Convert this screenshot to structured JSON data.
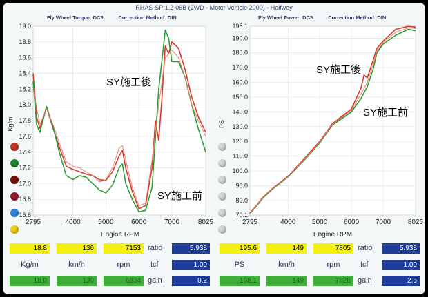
{
  "header": "RHAS-SP 1.2-06B  (2WD - Motor Vehicle 2000) - Halfway",
  "left_panel": {
    "title": "Fly Wheel Torque: DC5",
    "correction": "Correction Method: DIN",
    "readout": {
      "val1": "18.8",
      "val2": "136",
      "val3": "7153",
      "unit1": "Kg/m",
      "unit2": "km/h",
      "unit3": "rpm",
      "cmp1": "18.0",
      "cmp2": "130",
      "cmp3": "6834",
      "ratio_label": "ratio",
      "ratio": "5.938",
      "tcf_label": "tcf",
      "tcf": "1.00",
      "gain_label": "gain",
      "gain": "0.2"
    }
  },
  "right_panel": {
    "title": "Fly Wheel Power: DC5",
    "correction": "Correction Method: DIN",
    "readout": {
      "val1": "195.6",
      "val2": "149",
      "val3": "7805",
      "unit1": "PS",
      "unit2": "km/h",
      "unit3": "rpm",
      "cmp1": "198.1",
      "cmp2": "149",
      "cmp3": "7828",
      "ratio_label": "ratio",
      "ratio": "5.938",
      "tcf_label": "tcf",
      "tcf": "1.00",
      "gain_label": "gain",
      "gain": "2.6"
    }
  },
  "left_swatches": [
    "#c0392b",
    "#1e8c2e",
    "#7a1010",
    "#9b1c2c",
    "#2e86de",
    "#f1d21a"
  ],
  "right_swatches": [
    "#d6d6d6",
    "#d6d6d6",
    "#d6d6d6",
    "#d6d6d6",
    "#d6d6d6",
    "#d6d6d6"
  ],
  "chart_data": [
    {
      "type": "line",
      "title": "Fly Wheel Torque: DC5",
      "xlabel": "Engine RPM",
      "ylabel": "Kg/m",
      "xlim": [
        2795,
        8025
      ],
      "ylim": [
        16.6,
        19.0
      ],
      "x_ticks": [
        2795,
        4000,
        5000,
        6000,
        7000,
        8025
      ],
      "y_ticks": [
        16.6,
        16.8,
        17.0,
        17.2,
        17.4,
        17.6,
        17.8,
        18.0,
        18.2,
        18.4,
        18.6,
        18.8,
        19.0
      ],
      "annotations": [
        "SY施工後",
        "SY施工前"
      ],
      "series": [
        {
          "color": "#d63a2a",
          "x": [
            2795,
            2900,
            3000,
            3200,
            3400,
            3600,
            3800,
            4000,
            4200,
            4400,
            4600,
            4800,
            5000,
            5200,
            5400,
            5500,
            5600,
            5800,
            6000,
            6200,
            6400,
            6500,
            6600,
            6700,
            6800,
            6900,
            7000,
            7200,
            7400,
            7600,
            7800,
            8025
          ],
          "y": [
            18.4,
            17.85,
            17.7,
            17.97,
            17.7,
            17.45,
            17.22,
            17.18,
            17.15,
            17.12,
            17.1,
            17.05,
            17.04,
            17.15,
            17.35,
            17.42,
            17.2,
            16.9,
            16.68,
            16.72,
            17.2,
            17.8,
            17.55,
            18.1,
            18.75,
            18.65,
            18.8,
            18.72,
            18.45,
            18.1,
            17.85,
            17.65
          ]
        },
        {
          "color": "#2a9d35",
          "x": [
            2795,
            2900,
            3000,
            3200,
            3400,
            3600,
            3800,
            4000,
            4200,
            4400,
            4600,
            4800,
            5000,
            5200,
            5400,
            5500,
            5600,
            5800,
            6000,
            6200,
            6400,
            6600,
            6800,
            6900,
            7000,
            7200,
            7400,
            7600,
            7800,
            8025
          ],
          "y": [
            18.3,
            17.75,
            17.65,
            17.98,
            17.72,
            17.38,
            17.1,
            17.05,
            17.1,
            17.08,
            17.0,
            16.92,
            16.88,
            16.98,
            17.2,
            17.25,
            17.0,
            16.8,
            16.64,
            16.66,
            16.95,
            18.2,
            18.95,
            18.85,
            18.55,
            18.55,
            18.35,
            18.0,
            17.7,
            17.4
          ]
        },
        {
          "color": "#e57d72",
          "x": [
            2795,
            3000,
            3200,
            3400,
            3600,
            3800,
            4000,
            4200,
            4400,
            4600,
            4800,
            5000,
            5200,
            5400,
            5500,
            5600,
            5800,
            6000,
            6200,
            6400,
            6600,
            6800,
            7000,
            7200,
            7400,
            7600,
            7800,
            8025
          ],
          "y": [
            18.2,
            17.75,
            17.95,
            17.75,
            17.5,
            17.28,
            17.22,
            17.2,
            17.15,
            17.1,
            17.02,
            17.05,
            17.2,
            17.45,
            17.48,
            17.3,
            16.95,
            16.72,
            16.75,
            17.3,
            18.0,
            18.6,
            18.7,
            18.6,
            18.35,
            18.0,
            17.8,
            17.6
          ]
        }
      ]
    },
    {
      "type": "line",
      "title": "Fly Wheel Power: DC5",
      "xlabel": "Engine RPM",
      "ylabel": "PS",
      "xlim": [
        2795,
        8025
      ],
      "ylim": [
        70.1,
        198.1
      ],
      "x_ticks": [
        2795,
        4000,
        5000,
        6000,
        7000,
        8025
      ],
      "y_ticks": [
        70.1,
        80.0,
        90.0,
        100.0,
        110.0,
        120.0,
        130.0,
        140.0,
        150.0,
        160.0,
        170.0,
        180.0,
        190.0,
        198.1
      ],
      "annotations": [
        "SY施工後",
        "SY施工前"
      ],
      "series": [
        {
          "color": "#d63a2a",
          "x": [
            2795,
            3000,
            3200,
            3500,
            4000,
            4500,
            5000,
            5400,
            6000,
            6300,
            6400,
            6500,
            6700,
            6800,
            7000,
            7400,
            7800,
            8025
          ],
          "y": [
            71.5,
            76.5,
            82.0,
            88.0,
            96.5,
            108.0,
            120.0,
            132.0,
            142.0,
            156.0,
            165.0,
            163.0,
            176.0,
            183.0,
            188.0,
            196.0,
            198.0,
            197.5
          ]
        },
        {
          "color": "#2a9d35",
          "x": [
            2795,
            3000,
            3200,
            3500,
            4000,
            4500,
            5000,
            5400,
            6000,
            6300,
            6500,
            6700,
            6800,
            7000,
            7400,
            7800,
            8025
          ],
          "y": [
            71.0,
            76.0,
            81.5,
            87.5,
            96.0,
            107.0,
            119.0,
            131.0,
            140.0,
            149.0,
            157.0,
            170.0,
            180.0,
            186.0,
            192.0,
            196.0,
            195.0
          ]
        },
        {
          "color": "#e57d72",
          "x": [
            2795,
            3000,
            3200,
            3500,
            4000,
            4500,
            5000,
            5400,
            6000,
            6300,
            6500,
            6700,
            6800,
            7000,
            7400,
            7800,
            8025
          ],
          "y": [
            71.2,
            76.2,
            81.8,
            87.8,
            96.2,
            107.5,
            119.5,
            131.5,
            141.0,
            152.0,
            160.0,
            173.0,
            181.0,
            187.0,
            194.0,
            197.0,
            196.5
          ]
        }
      ]
    }
  ]
}
